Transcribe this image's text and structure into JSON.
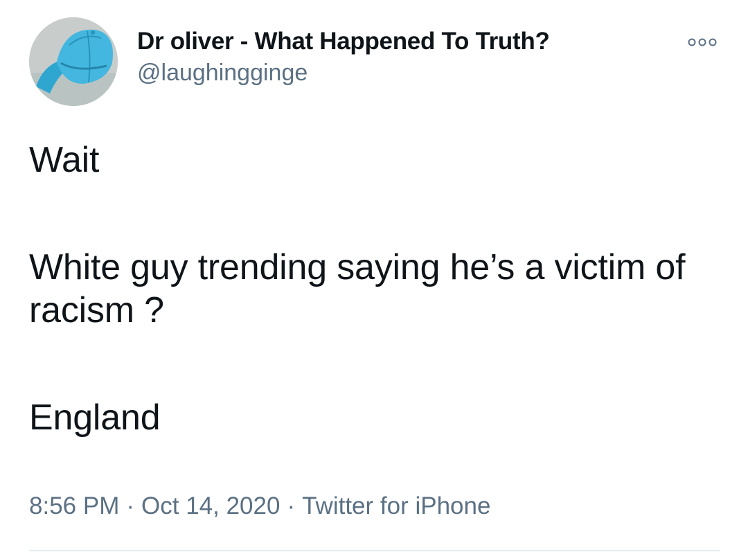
{
  "author": {
    "display_name": "Dr oliver - What Happened To Truth?",
    "handle": "@laughingginge",
    "avatar_icon": "blue-cap-photo"
  },
  "more_icon": "more-options-icon",
  "tweet": {
    "paragraphs": [
      "Wait",
      "White guy trending saying he’s a victim of racism ?",
      "England"
    ]
  },
  "meta": {
    "time": "8:56 PM",
    "separator": "·",
    "date": "Oct 14, 2020",
    "source": "Twitter for iPhone"
  },
  "colors": {
    "text": "#0f1419",
    "secondary": "#5b7083",
    "divider": "#e6ecf0",
    "avatar_cap": "#3fb1d9"
  }
}
